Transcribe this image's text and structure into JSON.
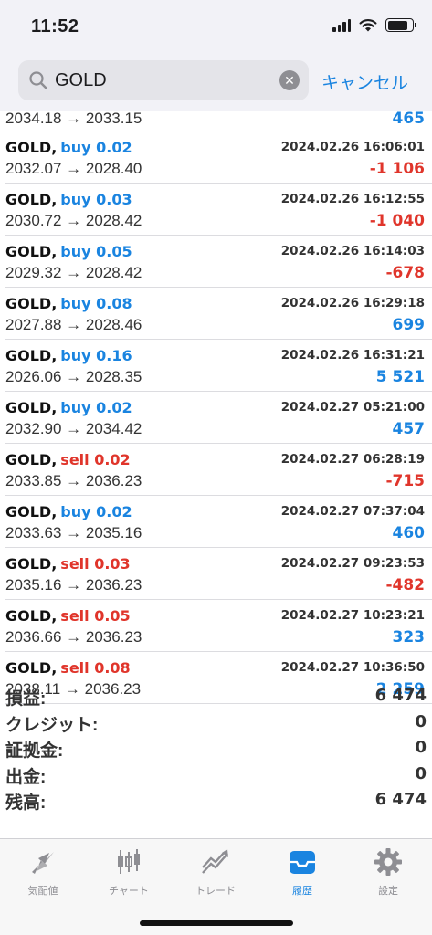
{
  "status": {
    "time": "11:52"
  },
  "search": {
    "value": "GOLD",
    "cancel": "キャンセル"
  },
  "partial_row": {
    "prices": "2034.18 → 2033.15",
    "profit": "465"
  },
  "deals": [
    {
      "symbol": "GOLD,",
      "side": "buy",
      "side_text": "buy 0.02",
      "time": "2024.02.26 16:06:01",
      "prices": "2032.07 → 2028.40",
      "profit": "-1 106"
    },
    {
      "symbol": "GOLD,",
      "side": "buy",
      "side_text": "buy 0.03",
      "time": "2024.02.26 16:12:55",
      "prices": "2030.72 → 2028.42",
      "profit": "-1 040"
    },
    {
      "symbol": "GOLD,",
      "side": "buy",
      "side_text": "buy 0.05",
      "time": "2024.02.26 16:14:03",
      "prices": "2029.32 → 2028.42",
      "profit": "-678"
    },
    {
      "symbol": "GOLD,",
      "side": "buy",
      "side_text": "buy 0.08",
      "time": "2024.02.26 16:29:18",
      "prices": "2027.88 → 2028.46",
      "profit": "699"
    },
    {
      "symbol": "GOLD,",
      "side": "buy",
      "side_text": "buy 0.16",
      "time": "2024.02.26 16:31:21",
      "prices": "2026.06 → 2028.35",
      "profit": "5 521"
    },
    {
      "symbol": "GOLD,",
      "side": "buy",
      "side_text": "buy 0.02",
      "time": "2024.02.27 05:21:00",
      "prices": "2032.90 → 2034.42",
      "profit": "457"
    },
    {
      "symbol": "GOLD,",
      "side": "sell",
      "side_text": "sell 0.02",
      "time": "2024.02.27 06:28:19",
      "prices": "2033.85 → 2036.23",
      "profit": "-715"
    },
    {
      "symbol": "GOLD,",
      "side": "buy",
      "side_text": "buy 0.02",
      "time": "2024.02.27 07:37:04",
      "prices": "2033.63 → 2035.16",
      "profit": "460"
    },
    {
      "symbol": "GOLD,",
      "side": "sell",
      "side_text": "sell 0.03",
      "time": "2024.02.27 09:23:53",
      "prices": "2035.16 → 2036.23",
      "profit": "-482"
    },
    {
      "symbol": "GOLD,",
      "side": "sell",
      "side_text": "sell 0.05",
      "time": "2024.02.27 10:23:21",
      "prices": "2036.66 → 2036.23",
      "profit": "323"
    },
    {
      "symbol": "GOLD,",
      "side": "sell",
      "side_text": "sell 0.08",
      "time": "2024.02.27 10:36:50",
      "prices": "2038.11 → 2036.23",
      "profit": "2 259"
    }
  ],
  "summary": [
    {
      "label": "損益:",
      "value": "6 474"
    },
    {
      "label": "クレジット:",
      "value": "0"
    },
    {
      "label": "証拠金:",
      "value": "0"
    },
    {
      "label": "出金:",
      "value": "0"
    },
    {
      "label": "残高:",
      "value": "6 474"
    }
  ],
  "tabs": [
    {
      "label": "気配値",
      "icon": "quotes-icon",
      "active": false
    },
    {
      "label": "チャート",
      "icon": "chart-icon",
      "active": false
    },
    {
      "label": "トレード",
      "icon": "trade-icon",
      "active": false
    },
    {
      "label": "履歴",
      "icon": "history-icon",
      "active": true
    },
    {
      "label": "設定",
      "icon": "settings-icon",
      "active": false
    }
  ],
  "colors": {
    "accent": "#1a84e0",
    "loss": "#e0352b",
    "inactive": "#8e8e93"
  }
}
